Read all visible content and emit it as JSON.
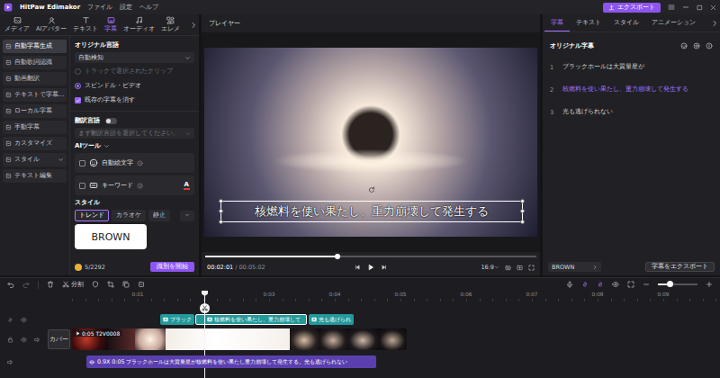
{
  "app": {
    "title": "HitPaw Edimakor",
    "menu": [
      "ファイル",
      "設定",
      "ヘルプ"
    ],
    "export_button": "エクスポート"
  },
  "tool_tabs": [
    {
      "label": "メディア",
      "selected": false
    },
    {
      "label": "AIアバター",
      "selected": false
    },
    {
      "label": "テキスト",
      "selected": false
    },
    {
      "label": "字幕",
      "selected": true
    },
    {
      "label": "オーディオ",
      "selected": false
    },
    {
      "label": "エレメ",
      "selected": false
    }
  ],
  "sidebar": {
    "items": [
      {
        "label": "自動字幕生成",
        "selected": true,
        "kind": "item"
      },
      {
        "label": "自動歌詞認識",
        "selected": false,
        "kind": "item"
      },
      {
        "label": "動画翻訳",
        "selected": false,
        "kind": "item"
      },
      {
        "label": "テキストで字幕...",
        "selected": false,
        "kind": "item"
      },
      {
        "label": "ローカル字幕",
        "selected": false,
        "kind": "item"
      },
      {
        "label": "手動字幕",
        "selected": false,
        "kind": "item"
      },
      {
        "label": "カスタマイズ",
        "selected": false,
        "kind": "item"
      },
      {
        "label": "スタイル",
        "selected": false,
        "kind": "group"
      },
      {
        "label": "テキスト編集",
        "selected": false,
        "kind": "item"
      }
    ]
  },
  "settings": {
    "original_language": {
      "title": "オリジナル言語",
      "value": "自動検知"
    },
    "scope": [
      {
        "label": "トラックで選択されたクリップ",
        "selected": false,
        "disabled": true
      },
      {
        "label": "スピンドル・ビデオ",
        "selected": true,
        "disabled": false
      }
    ],
    "clear_existing": {
      "label": "既存の字幕を消す",
      "checked": true
    },
    "translation": {
      "title": "翻訳言語",
      "on": false,
      "placeholder": "まず翻訳言語を選択してください。"
    },
    "ai_tools": {
      "title": "AIツール",
      "items": [
        {
          "label": "自動絵文字",
          "checked": false
        },
        {
          "label": "キーワード",
          "checked": false,
          "color_icon": "A"
        }
      ]
    },
    "style": {
      "title": "スタイル",
      "tabs": [
        {
          "label": "トレンド",
          "selected": true
        },
        {
          "label": "カラオケ",
          "selected": false
        },
        {
          "label": "静止",
          "selected": false
        }
      ],
      "preview": "BROWN"
    },
    "credits": "5/2292",
    "start_button": "識別を開始"
  },
  "player": {
    "title": "プレイヤー",
    "subtitle": "核燃料を使い果たし、重力崩壊して発生する",
    "level": 0.4,
    "current_time": "00:02:01",
    "total_time": "/ 00:05:02",
    "aspect": "16:9"
  },
  "subtitle_panel": {
    "tabs": [
      {
        "label": "字幕",
        "selected": true
      },
      {
        "label": "テキスト",
        "selected": false
      },
      {
        "label": "スタイル",
        "selected": false
      },
      {
        "label": "アニメーション",
        "selected": false
      }
    ],
    "title": "オリジナル字幕",
    "rows": [
      {
        "index": "1",
        "text": "ブラックホールは大質量星が",
        "selected": false
      },
      {
        "index": "2",
        "text": "核燃料を使い果たし、重力崩壊して発生する",
        "selected": true
      },
      {
        "index": "3",
        "text": "光も逃げられない",
        "selected": false
      }
    ],
    "style_select": "BROWN",
    "export_button": "字幕をエクスポート"
  },
  "timeline": {
    "split": "分割",
    "zoom": {
      "level": 0.3
    },
    "ruler": [
      "0:01",
      "0:03",
      "0:04",
      "0:05",
      "0:06",
      "0:07",
      "0:08",
      "0:09"
    ],
    "subtitle_clips": [
      {
        "label": "ブラック",
        "selected": false
      },
      {
        "label": "核燃料を使い果たし、重力崩壊して",
        "selected": true
      },
      {
        "label": "光も逃げられ",
        "selected": false
      }
    ],
    "cover": "カバー",
    "video_clip": "0:05 T2V0008",
    "audio_clip": "0.9X 0:05 ブラックホールは大質量星が核燃料を使い果たし重力崩壊して発生する。光も逃げられない"
  }
}
